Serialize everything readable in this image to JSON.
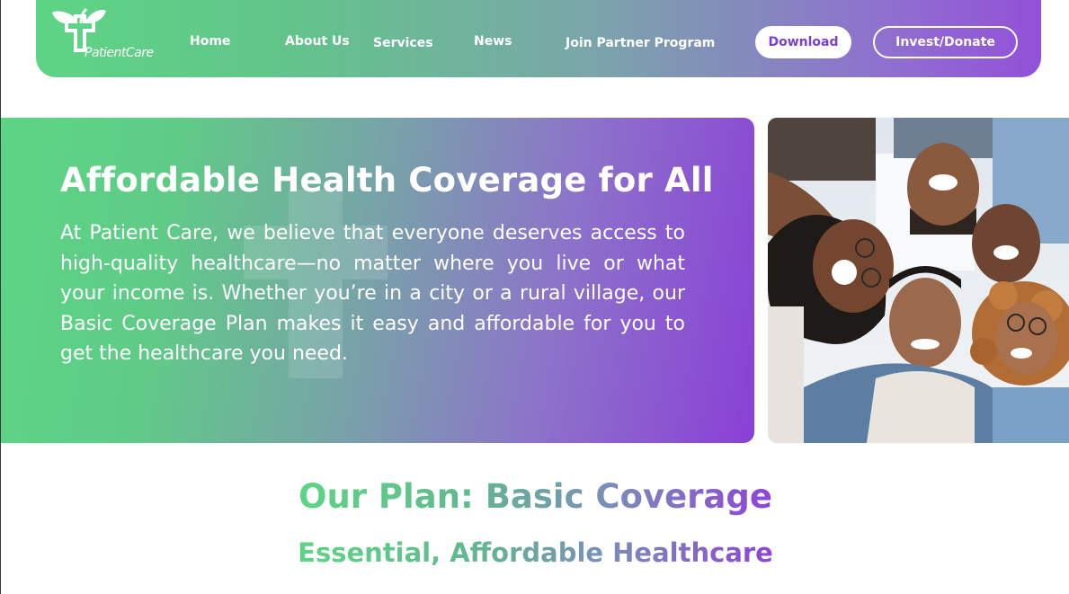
{
  "brand": {
    "name": "PatientCare",
    "gradient_start": "#5dd585",
    "gradient_end": "#8a40d6"
  },
  "nav": {
    "links": [
      {
        "label": "Home"
      },
      {
        "label": "About Us"
      },
      {
        "label": "Services"
      },
      {
        "label": "News"
      },
      {
        "label": "Join Partner Program"
      }
    ],
    "download_label": "Download",
    "invest_label": "Invest/Donate"
  },
  "hero": {
    "title": "Affordable Health Coverage for All",
    "body": "At Patient Care, we believe that everyone deserves access to high-quality healthcare—no matter where you live or what your income is. Whether you’re in a city or a rural village, our Basic Coverage Plan makes it easy and affordable for you to get the healthcare you need."
  },
  "plan": {
    "title": "Our Plan: Basic Coverage",
    "subtitle": "Essential, Affordable Healthcare"
  }
}
